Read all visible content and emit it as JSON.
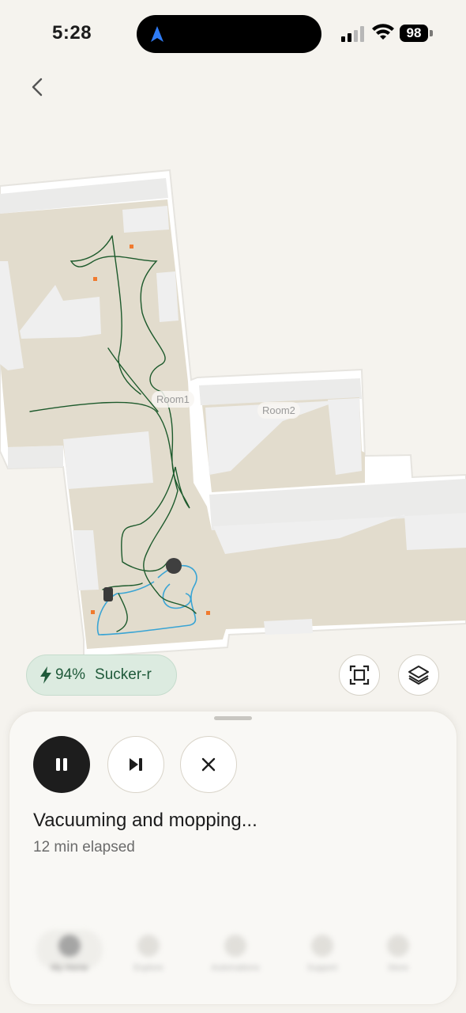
{
  "status_bar": {
    "time": "5:28",
    "battery": "98"
  },
  "map": {
    "rooms": [
      {
        "name": "Room1"
      },
      {
        "name": "Room2"
      }
    ],
    "colors": {
      "floor": "#e2dccd",
      "wall": "#ffffff",
      "path": "#1d5a2c",
      "mop_path": "#39a4d4",
      "marker": "#f07a2e",
      "robot": "#3f3f3f"
    }
  },
  "robot": {
    "battery": "94%",
    "name": "Sucker-r"
  },
  "controls": {
    "pause_icon": "pause-icon",
    "skip_icon": "skip-next-icon",
    "stop_icon": "close-icon"
  },
  "task": {
    "status": "Vacuuming and mopping...",
    "elapsed": "12 min elapsed"
  },
  "tabbar": {
    "items": [
      {
        "label": "My Home",
        "icon": "home-icon"
      },
      {
        "label": "Explore",
        "icon": "explore-icon"
      },
      {
        "label": "Automations",
        "icon": "automation-icon"
      },
      {
        "label": "Support",
        "icon": "support-icon"
      },
      {
        "label": "Store",
        "icon": "cart-icon"
      }
    ]
  }
}
